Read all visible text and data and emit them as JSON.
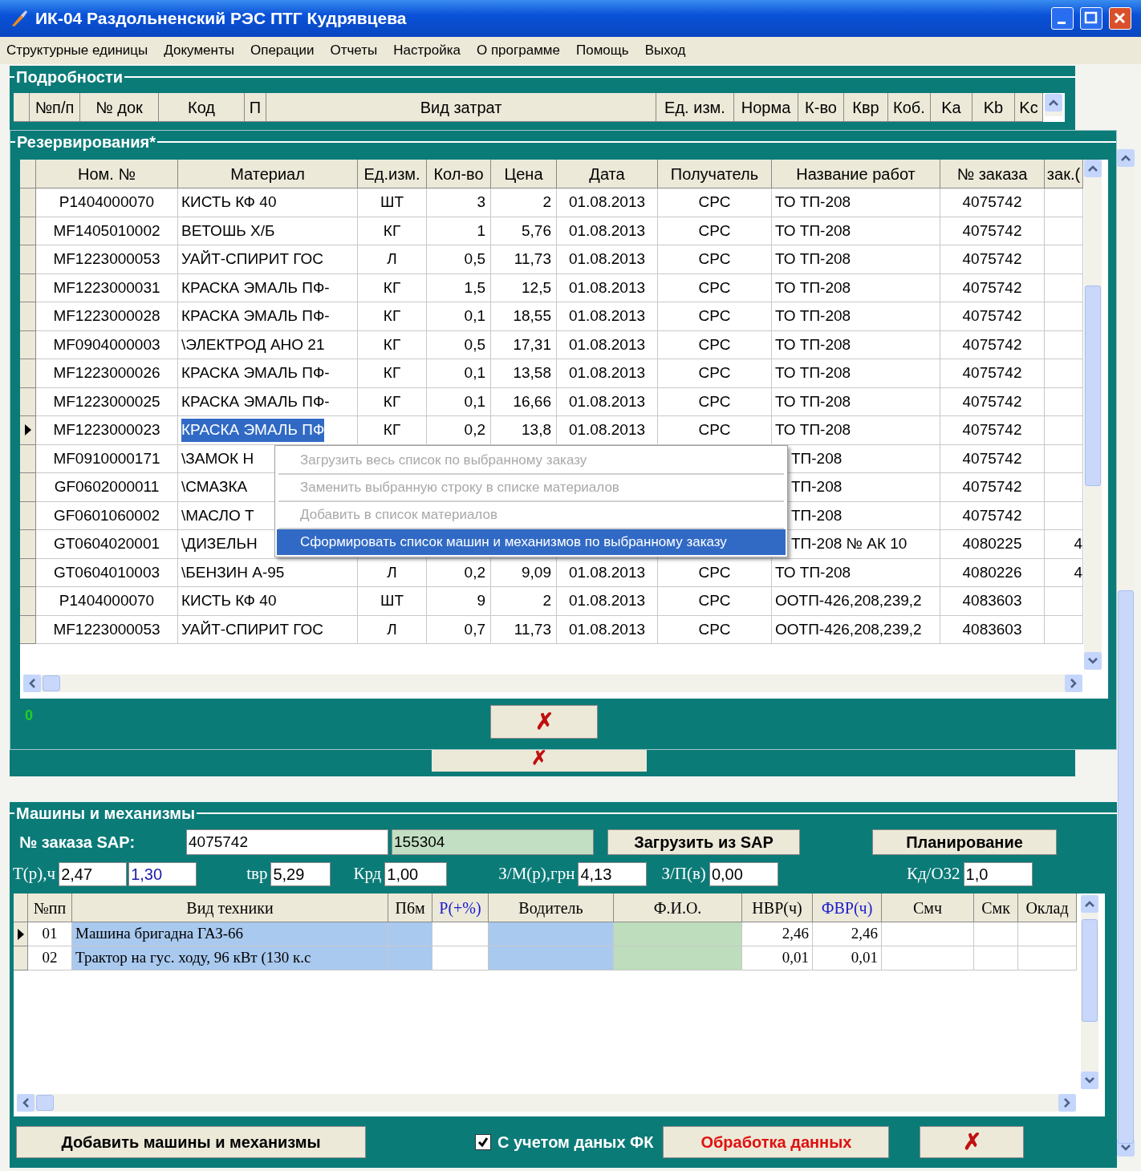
{
  "window": {
    "title": "ИК-04 Раздольненский РЭС ПТГ Кудрявцева"
  },
  "menu": [
    "Структурные единицы",
    "Документы",
    "Операции",
    "Отчеты",
    "Настройка",
    "О программе",
    "Помощь",
    "Выход"
  ],
  "details": {
    "title": "Подробности",
    "columns": [
      "№п/п",
      "№ док",
      "Код",
      "П",
      "Вид затрат",
      "Ед. изм.",
      "Норма",
      "К-во",
      "Квр",
      "Коб.",
      "Ka",
      "Kb",
      "Kc"
    ],
    "button": "✗"
  },
  "reservations": {
    "title": "Резервирования*",
    "columns": [
      "Ном. №",
      "Материал",
      "Ед.изм.",
      "Кол-во",
      "Цена",
      "Дата",
      "Получатель",
      "Название работ",
      "№ заказа",
      "зак.("
    ],
    "rows": [
      {
        "selected": false,
        "cells": [
          "P1404000070",
          "КИСТЬ  КФ 40",
          "ШТ",
          "3",
          "2",
          "01.08.2013",
          "СРС",
          "ТО ТП-208",
          "4075742",
          null
        ]
      },
      {
        "selected": false,
        "cells": [
          "MF1405010002",
          "ВЕТОШЬ Х/Б",
          "КГ",
          "1",
          "5,76",
          "01.08.2013",
          "СРС",
          "ТО ТП-208",
          "4075742",
          null
        ]
      },
      {
        "selected": false,
        "cells": [
          "MF1223000053",
          "УАЙТ-СПИРИТ ГОС",
          "Л",
          "0,5",
          "11,73",
          "01.08.2013",
          "СРС",
          "ТО ТП-208",
          "4075742",
          null
        ]
      },
      {
        "selected": false,
        "cells": [
          "MF1223000031",
          "КРАСКА ЭМАЛЬ ПФ-",
          "КГ",
          "1,5",
          "12,5",
          "01.08.2013",
          "СРС",
          "ТО ТП-208",
          "4075742",
          null
        ]
      },
      {
        "selected": false,
        "cells": [
          "MF1223000028",
          "КРАСКА ЭМАЛЬ ПФ-",
          "КГ",
          "0,1",
          "18,55",
          "01.08.2013",
          "СРС",
          "ТО ТП-208",
          "4075742",
          null
        ]
      },
      {
        "selected": false,
        "cells": [
          "MF0904000003",
          "\\ЭЛЕКТРОД АНО 21",
          "КГ",
          "0,5",
          "17,31",
          "01.08.2013",
          "СРС",
          "ТО ТП-208",
          "4075742",
          null
        ]
      },
      {
        "selected": false,
        "cells": [
          "MF1223000026",
          "КРАСКА ЭМАЛЬ ПФ-",
          "КГ",
          "0,1",
          "13,58",
          "01.08.2013",
          "СРС",
          "ТО ТП-208",
          "4075742",
          null
        ]
      },
      {
        "selected": false,
        "cells": [
          "MF1223000025",
          "КРАСКА ЭМАЛЬ ПФ-",
          "КГ",
          "0,1",
          "16,66",
          "01.08.2013",
          "СРС",
          "ТО ТП-208",
          "4075742",
          null
        ]
      },
      {
        "selected": true,
        "cells": [
          "MF1223000023",
          "КРАСКА ЭМАЛЬ ПФ",
          "КГ",
          "0,2",
          "13,8",
          "01.08.2013",
          "СРС",
          "ТО ТП-208",
          "4075742",
          null
        ]
      },
      {
        "selected": false,
        "cells": [
          "MF0910000171",
          "\\ЗАМОК Н",
          null,
          null,
          null,
          null,
          null,
          "ТП-208",
          "4075742",
          null
        ]
      },
      {
        "selected": false,
        "cells": [
          "GF0602000011",
          "\\СМАЗКА",
          null,
          null,
          null,
          null,
          null,
          "ТП-208",
          "4075742",
          null
        ]
      },
      {
        "selected": false,
        "cells": [
          "GF0601060002",
          "\\МАСЛО Т",
          null,
          null,
          null,
          null,
          null,
          "ТП-208",
          "4075742",
          null
        ]
      },
      {
        "selected": false,
        "cells": [
          "GT0604020001",
          "\\ДИЗЕЛЬН",
          null,
          null,
          null,
          null,
          null,
          "ТП-208 № АК 10",
          "4080225",
          "4"
        ]
      },
      {
        "selected": false,
        "cells": [
          "GT0604010003",
          "\\БЕНЗИН А-95",
          "Л",
          "0,2",
          "9,09",
          "01.08.2013",
          "СРС",
          "ТО ТП-208",
          "4080226",
          "4"
        ]
      },
      {
        "selected": false,
        "cells": [
          "P1404000070",
          "КИСТЬ  КФ 40",
          "ШТ",
          "9",
          "2",
          "01.08.2013",
          "СРС",
          "ООТП-426,208,239,2",
          "4083603",
          null
        ]
      },
      {
        "selected": false,
        "cells": [
          "MF1223000053",
          "УАЙТ-СПИРИТ ГОС",
          "Л",
          "0,7",
          "11,73",
          "01.08.2013",
          "СРС",
          "ООТП-426,208,239,2",
          "4083603",
          null
        ]
      }
    ],
    "counter": "0",
    "button": "✗"
  },
  "context_menu": [
    {
      "label": "Загрузить весь список по выбранному заказу",
      "disabled": true,
      "selected": false
    },
    {
      "label": "Заменить выбранную строку в списке материалов",
      "disabled": true,
      "selected": false
    },
    {
      "label": "Добавить в список материалов",
      "disabled": true,
      "selected": false
    },
    {
      "label": "Сформировать список машин и механизмов  по выбранному заказу",
      "disabled": false,
      "selected": true
    }
  ],
  "machines": {
    "title": "Машины и механизмы",
    "sap_label": "№ заказа SAP:",
    "sap_order": "4075742",
    "sap_code": "155304",
    "load_button": "Загрузить из SAP",
    "plan_button": "Планирование",
    "params": [
      {
        "label": "Т(р),ч",
        "values": [
          {
            "text": "2,47",
            "color": "#000000"
          },
          {
            "text": "1,30",
            "color": "#1a1aa8"
          }
        ]
      },
      {
        "label": "tвр",
        "values": [
          {
            "text": "5,29",
            "color": "#000000"
          }
        ]
      },
      {
        "label": "Крд",
        "values": [
          {
            "text": "1,00",
            "color": "#000000"
          }
        ]
      },
      {
        "label": "З/М(р),грн",
        "values": [
          {
            "text": "4,13",
            "color": "#000000"
          }
        ]
      },
      {
        "label": "З/П(в)",
        "values": [
          {
            "text": "0,00",
            "color": "#000000"
          }
        ]
      },
      {
        "label": "Кд/О32",
        "values": [
          {
            "text": "1,0",
            "color": "#000000"
          }
        ]
      }
    ],
    "columns": [
      {
        "label": "№пп",
        "color": "#000000"
      },
      {
        "label": "Вид техники",
        "color": "#000000"
      },
      {
        "label": "П6м",
        "color": "#000000"
      },
      {
        "label": "Р(+%)",
        "color": "#1a1ad0"
      },
      {
        "label": "Водитель",
        "color": "#000000"
      },
      {
        "label": "Ф.И.О.",
        "color": "#000000"
      },
      {
        "label": "НВР(ч)",
        "color": "#000000"
      },
      {
        "label": "ФВР(ч)",
        "color": "#1a1ad0"
      },
      {
        "label": "Смч",
        "color": "#000000"
      },
      {
        "label": "Смк",
        "color": "#000000"
      },
      {
        "label": "Оклад",
        "color": "#000000"
      }
    ],
    "rows": [
      {
        "selected": true,
        "cells": [
          "01",
          "Машина бригадна ГАЗ-66",
          null,
          null,
          null,
          null,
          "2,46",
          "2,46",
          null,
          null,
          null
        ]
      },
      {
        "selected": false,
        "cells": [
          "02",
          "Трактор на гус. ходу, 96 кВт (130 к.с",
          null,
          null,
          null,
          null,
          "0,01",
          "0,01",
          null,
          null,
          null
        ]
      }
    ],
    "add_button": "Добавить машины и механизмы",
    "fk_checkbox": {
      "label": "С учетом даных ФК",
      "checked": true
    },
    "process_button": "Обработка данных",
    "close_button": "✗"
  }
}
